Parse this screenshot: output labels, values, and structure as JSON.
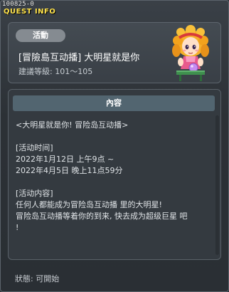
{
  "window": {
    "id": "100825-0",
    "title": "QUEST INFO"
  },
  "quest": {
    "category": "活動",
    "title": "[冒險島互动播] 大明星就是你",
    "recommended_level": "建議等級: 101～105"
  },
  "content": {
    "header": "內容",
    "lines": [
      "<大明星就是你! 冒险岛互动播>",
      "",
      "[活动时间]",
      "2022年1月12日 上午9点 ~",
      "2022年4月5日 晚上11点59分",
      "",
      "[活动内容]",
      "任何人都能成为冒险岛互动播 里的大明星!",
      "冒险岛互动播等着你的到来, 快去成为超级巨星 吧",
      "!"
    ]
  },
  "status": "狀態: 可開始",
  "colors": {
    "title_yellow": "#ffe34a",
    "badge_gray": "#858b91",
    "content_header": "#526570",
    "panel_border": "#5d656d"
  },
  "icons": {
    "close": "close-icon",
    "npc": "npc-portrait"
  }
}
